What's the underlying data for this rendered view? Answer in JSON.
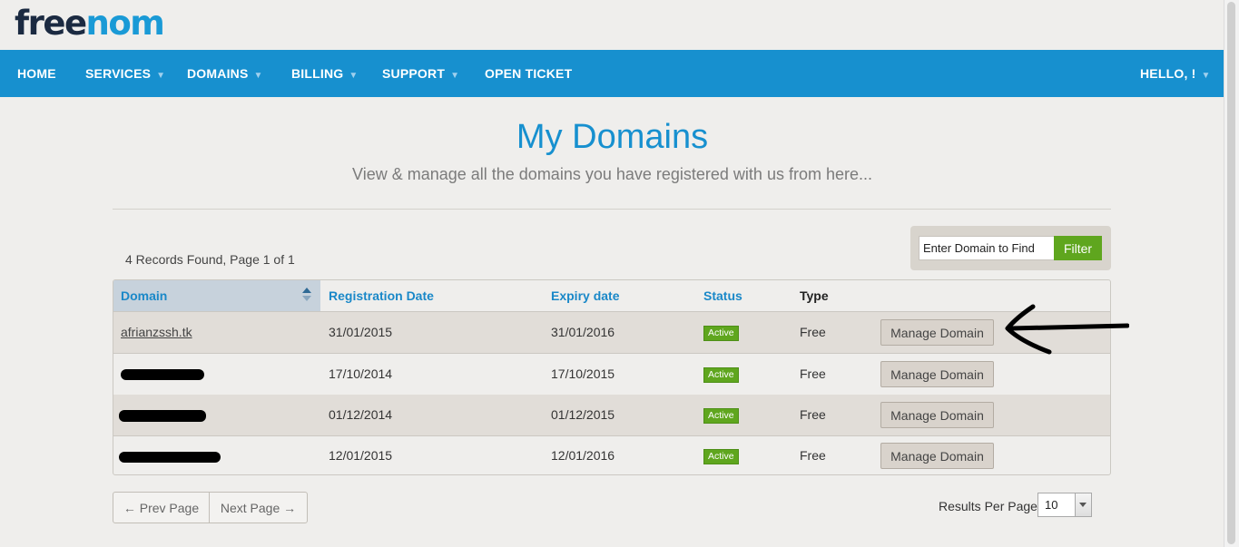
{
  "brand": {
    "part1": "free",
    "part2": "nom"
  },
  "nav": {
    "items": [
      {
        "label": "HOME",
        "dropdown": false
      },
      {
        "label": "SERVICES",
        "dropdown": true
      },
      {
        "label": "DOMAINS",
        "dropdown": true
      },
      {
        "label": "BILLING",
        "dropdown": true
      },
      {
        "label": "SUPPORT",
        "dropdown": true
      },
      {
        "label": "OPEN TICKET",
        "dropdown": false
      }
    ],
    "user": {
      "label": "HELLO, !",
      "dropdown": true
    }
  },
  "page": {
    "title": "My Domains",
    "subtitle": "View & manage all the domains you have registered with us from here..."
  },
  "filter": {
    "placeholder": "Enter Domain to Find",
    "button_label": "Filter"
  },
  "records_text": "4 Records Found, Page 1 of 1",
  "table": {
    "headers": {
      "domain": "Domain",
      "registration": "Registration Date",
      "expiry": "Expiry date",
      "status": "Status",
      "type": "Type"
    },
    "rows": [
      {
        "domain": "afrianzssh.tk",
        "redacted": false,
        "registration": "31/01/2015",
        "expiry": "31/01/2016",
        "status": "Active",
        "type": "Free",
        "action": "Manage Domain"
      },
      {
        "domain": "",
        "redacted": true,
        "registration": "17/10/2014",
        "expiry": "17/10/2015",
        "status": "Active",
        "type": "Free",
        "action": "Manage Domain"
      },
      {
        "domain": "",
        "redacted": true,
        "registration": "01/12/2014",
        "expiry": "01/12/2015",
        "status": "Active",
        "type": "Free",
        "action": "Manage Domain"
      },
      {
        "domain": "",
        "redacted": true,
        "registration": "12/01/2015",
        "expiry": "12/01/2016",
        "status": "Active",
        "type": "Free",
        "action": "Manage Domain"
      }
    ]
  },
  "pagination": {
    "prev": "← Prev Page",
    "next": "Next Page →"
  },
  "results_per_page": {
    "label": "Results Per Page:",
    "value": "10"
  },
  "colors": {
    "nav_bg": "#1790cf",
    "accent": "#1790cf",
    "active_badge": "#5fa61e",
    "filter_button": "#5fa61e"
  }
}
